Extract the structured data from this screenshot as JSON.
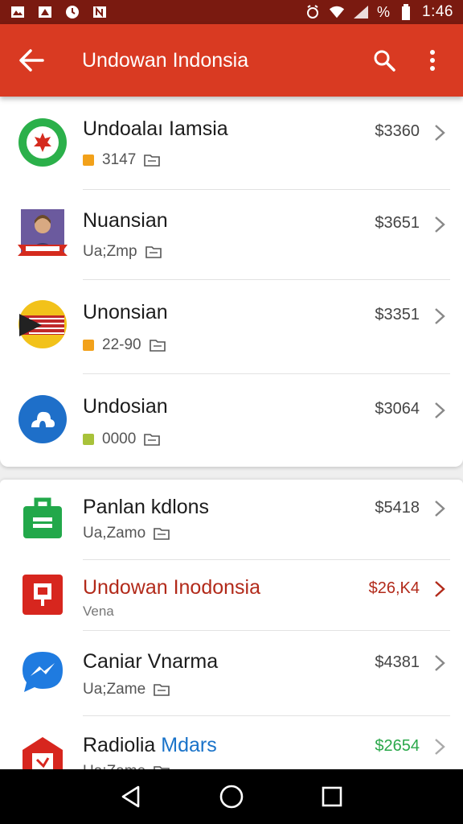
{
  "status_bar": {
    "time": "1:46",
    "battery_label": "%",
    "left_icons": [
      "image-notification-icon",
      "gallery-notification-icon",
      "clock-notification-icon",
      "news-notification-icon"
    ],
    "right_icons": [
      "alarm-icon",
      "wifi-icon",
      "signal-icon",
      "battery-icon"
    ]
  },
  "app_bar": {
    "title": "Undowan Indonsia",
    "background": "#d93a22",
    "icons": [
      "back-arrow-icon",
      "search-icon",
      "more-vert-icon"
    ]
  },
  "list_top": [
    {
      "title": "Undoalaı Iamsia",
      "sub": "3147",
      "price": "$3360",
      "square_color": "#f2a11a",
      "icon": "red-leaf-circle-icon"
    },
    {
      "title": "Nuansian",
      "sub": "Ua;Zmp",
      "price": "$3651",
      "square_color": "",
      "icon": "portrait-badge-icon"
    },
    {
      "title": "Unonsian",
      "sub": "22-90",
      "price": "$3351",
      "square_color": "#f2a11a",
      "icon": "flag-circle-icon"
    },
    {
      "title": "Undosian",
      "sub": "0000",
      "price": "$3064",
      "square_color": "#a8c23a",
      "icon": "cloud-circle-icon"
    }
  ],
  "list_bottom": [
    {
      "title": "Panlan kdlons",
      "sub": "Ua,Zamo",
      "price": "$5418",
      "icon": "briefcase-icon"
    },
    {
      "title": "Undowan Inodonsia",
      "sub": "Vena",
      "price": "$26,K4",
      "icon": "red-box-icon",
      "highlight": "#b22a1a"
    },
    {
      "title": "Caniar Vnarma",
      "sub": "Ua;Zame",
      "price": "$4381",
      "icon": "messenger-icon"
    },
    {
      "title_a": "Radiolia ",
      "title_b": "Mdars",
      "sub": "Ua;Zame",
      "price": "$2654",
      "icon": "red-shield-icon",
      "price_color": "#2aa84a"
    }
  ],
  "nav_bar": {
    "icons": [
      "nav-back-icon",
      "nav-home-icon",
      "nav-recents-icon"
    ]
  }
}
